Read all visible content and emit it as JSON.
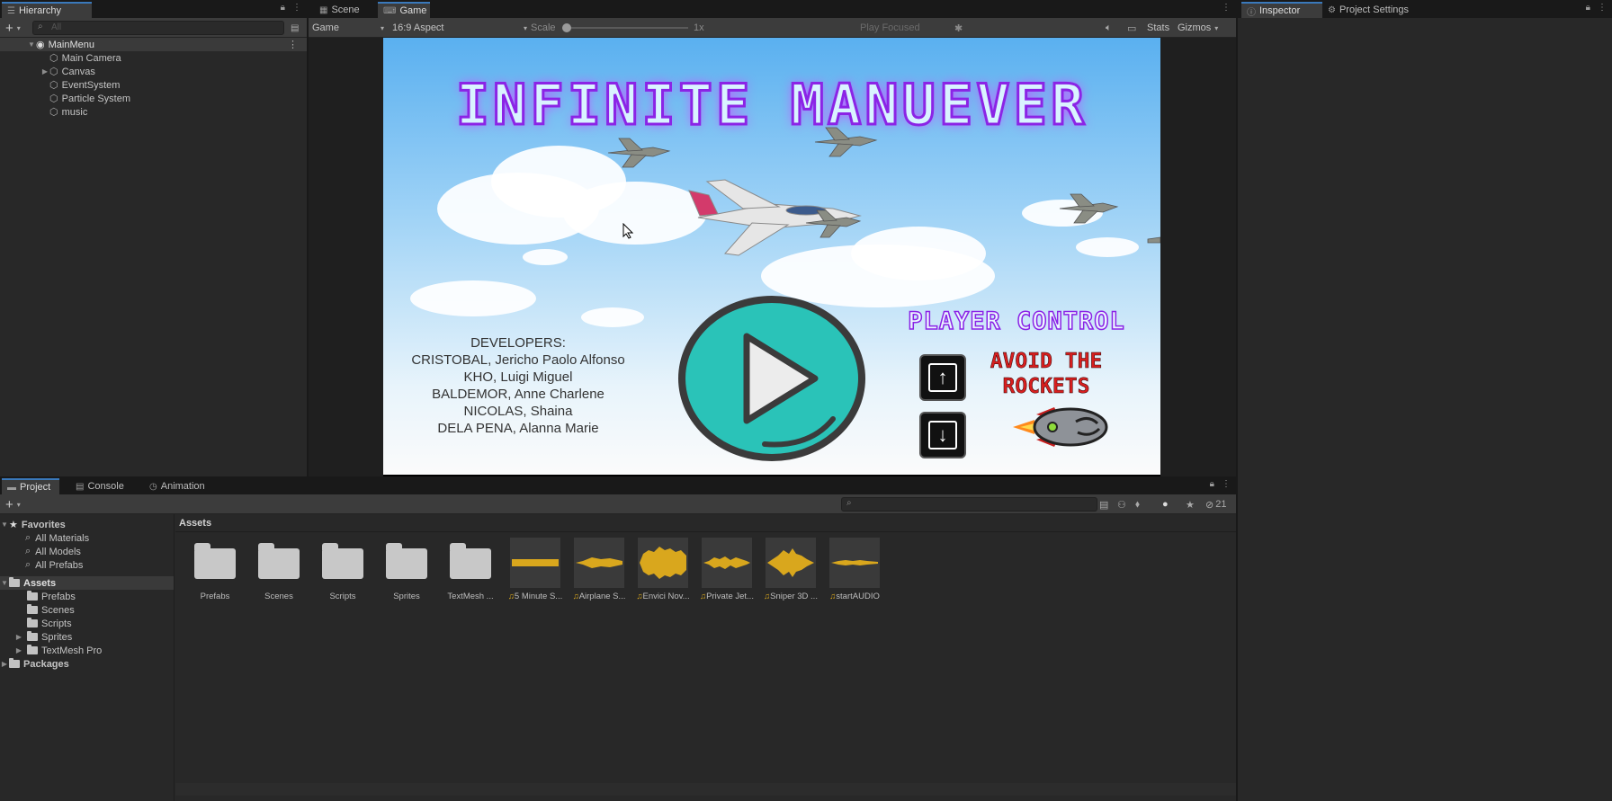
{
  "hierarchy": {
    "tab_label": "Hierarchy",
    "search_placeholder": "All",
    "scene_name": "MainMenu",
    "items": [
      {
        "label": "Main Camera",
        "expandable": false
      },
      {
        "label": "Canvas",
        "expandable": true
      },
      {
        "label": "EventSystem",
        "expandable": false
      },
      {
        "label": "Particle System",
        "expandable": false
      },
      {
        "label": "music",
        "expandable": false
      }
    ]
  },
  "center": {
    "tabs": [
      {
        "label": "Scene",
        "icon": "grid-icon",
        "active": false
      },
      {
        "label": "Game",
        "icon": "gamepad-icon",
        "active": true
      }
    ],
    "toolbar": {
      "display_select": "Game",
      "aspect_select": "16:9 Aspect",
      "scale_label": "Scale",
      "scale_value": "1x",
      "play_mode": "Play Focused",
      "stats_label": "Stats",
      "gizmos_label": "Gizmos"
    }
  },
  "game": {
    "title": "INFINITE MANUEVER",
    "developers_heading": "DEVELOPERS:",
    "developers": [
      "CRISTOBAL, Jericho Paolo Alfonso",
      "KHO, Luigi Miguel",
      "BALDEMOR, Anne Charlene",
      "NICOLAS, Shaina",
      "DELA PENA, Alanna Marie"
    ],
    "player_control": "PLAYER CONTROL",
    "avoid_line1": "AVOID THE",
    "avoid_line2": "ROCKETS",
    "key_up": "↑",
    "key_down": "↓"
  },
  "inspector": {
    "tabs": [
      {
        "label": "Inspector",
        "icon": "info-icon"
      },
      {
        "label": "Project Settings",
        "icon": "gear-icon"
      }
    ]
  },
  "bottom": {
    "tabs": [
      {
        "label": "Project",
        "icon": "folder-icon",
        "active": true
      },
      {
        "label": "Console",
        "icon": "console-icon",
        "active": false
      },
      {
        "label": "Animation",
        "icon": "clock-icon",
        "active": false
      }
    ],
    "count_badge": "21",
    "favorites": {
      "label": "Favorites",
      "items": [
        "All Materials",
        "All Models",
        "All Prefabs"
      ]
    },
    "assets_tree": {
      "label": "Assets",
      "items": [
        "Prefabs",
        "Scenes",
        "Scripts",
        "Sprites",
        "TextMesh Pro"
      ]
    },
    "packages_label": "Packages",
    "breadcrumb": "Assets",
    "assets": [
      {
        "label": "Prefabs",
        "kind": "folder"
      },
      {
        "label": "Scenes",
        "kind": "folder"
      },
      {
        "label": "Scripts",
        "kind": "folder"
      },
      {
        "label": "Sprites",
        "kind": "folder"
      },
      {
        "label": "TextMesh ...",
        "kind": "folder"
      },
      {
        "label": "5 Minute S...",
        "kind": "audio"
      },
      {
        "label": "Airplane S...",
        "kind": "audio"
      },
      {
        "label": "Envici Nov...",
        "kind": "audio"
      },
      {
        "label": "Private Jet...",
        "kind": "audio"
      },
      {
        "label": "Sniper 3D ...",
        "kind": "audio"
      },
      {
        "label": "startAUDIO",
        "kind": "audio"
      }
    ]
  },
  "colors": {
    "accent": "#3a79bb",
    "audio_wave": "#d9a71d",
    "title_stroke": "#8b24e6",
    "play_button": "#2ac3b8",
    "avoid_text": "#d71f1f"
  }
}
